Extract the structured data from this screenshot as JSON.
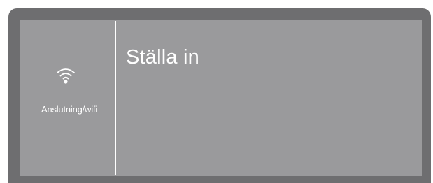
{
  "menu": {
    "item": {
      "icon": "wifi-icon",
      "label": "Anslutning/wifi"
    }
  },
  "main": {
    "title": "Ställa in"
  },
  "colors": {
    "bezel": "#6e6e70",
    "screen": "#9a9a9c",
    "text": "#ffffff"
  }
}
